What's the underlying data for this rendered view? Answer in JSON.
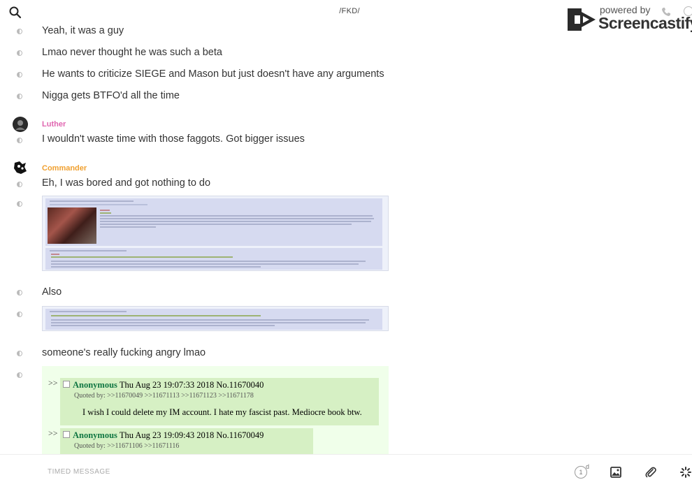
{
  "header": {
    "title": "/FKD/",
    "search_icon": "search-icon"
  },
  "watermark": {
    "powered": "powered by",
    "brand": "Screencastify"
  },
  "messages": [
    {
      "text": "Yeah, it was a guy"
    },
    {
      "text": "Lmao never thought he was such a beta"
    },
    {
      "text": "He wants to criticize SIEGE and Mason but just doesn't have any arguments"
    },
    {
      "text": "Nigga gets BTFO'd all the time"
    },
    {
      "sender": "Luther",
      "sender_color": "#e066b0",
      "text": "I wouldn't waste time with those faggots. Got bigger issues"
    },
    {
      "sender": "Commander",
      "sender_color": "#f0a030",
      "text": "Eh, I was bored and got nothing to do"
    },
    {
      "text": "Also"
    },
    {
      "text": "someone's really fucking angry lmao"
    }
  ],
  "green_post": {
    "replies": [
      {
        "arrows": ">>",
        "name": "Anonymous",
        "datetime": "Thu Aug 23 19:07:33 2018",
        "number": "No.11670040",
        "quoted_by": "Quoted by: >>11670049 >>11671113 >>11671123 >>11671178",
        "body": "I wish I could delete my IM account. I hate my fascist past. Mediocre book btw."
      },
      {
        "arrows": ">>",
        "name": "Anonymous",
        "datetime": "Thu Aug 23 19:09:43 2018",
        "number": "No.11670049",
        "quoted_by": "Quoted by: >>11671106 >>11671116"
      }
    ]
  },
  "composer": {
    "placeholder": "TIMED MESSAGE",
    "timer_value": "1",
    "timer_unit": "d"
  },
  "colors": {
    "accent_luther": "#e066b0",
    "accent_commander": "#f0a030",
    "post_blue": "#d6daf0",
    "post_green": "#d6f0c4"
  }
}
